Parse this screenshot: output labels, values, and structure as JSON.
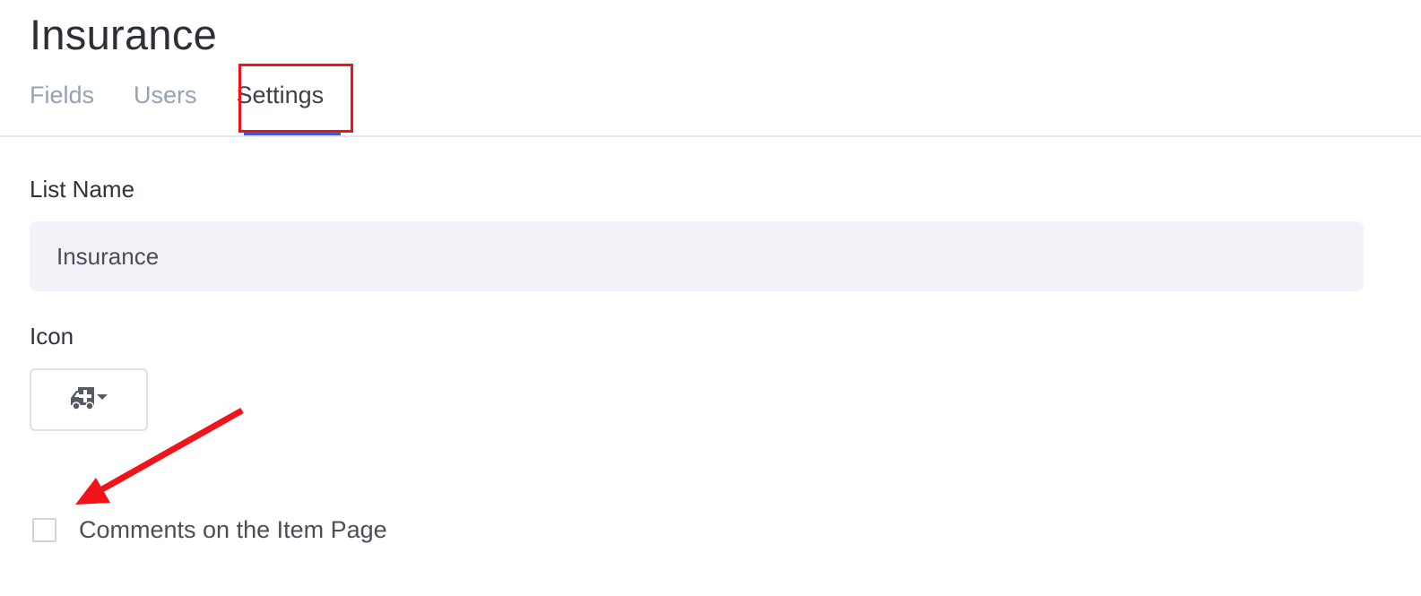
{
  "header": {
    "title": "Insurance"
  },
  "tabs": [
    {
      "label": "Fields",
      "active": false
    },
    {
      "label": "Users",
      "active": false
    },
    {
      "label": "Settings",
      "active": true
    }
  ],
  "form": {
    "list_name_label": "List Name",
    "list_name_value": "Insurance",
    "icon_label": "Icon",
    "icon_name": "ambulance-icon",
    "comments_label": "Comments on the Item Page",
    "comments_checked": false
  },
  "colors": {
    "accent": "#3d5bdb",
    "annotation": "#f0141a"
  }
}
